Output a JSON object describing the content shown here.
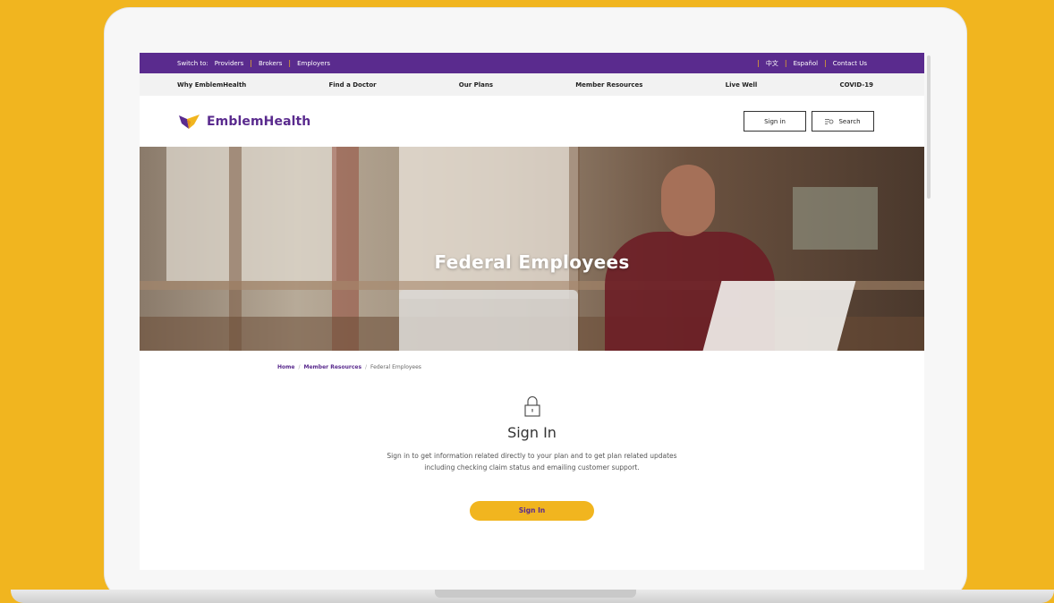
{
  "utility": {
    "switch_label": "Switch to:",
    "links": [
      "Providers",
      "Brokers",
      "Employers"
    ],
    "right_links": [
      "中文",
      "Español",
      "Contact Us"
    ]
  },
  "nav": {
    "items": [
      "Why EmblemHealth",
      "Find a Doctor",
      "Our Plans",
      "Member Resources",
      "Live Well",
      "COVID-19"
    ]
  },
  "header": {
    "logo_text": "EmblemHealth",
    "signin_label": "Sign in",
    "search_label": "Search"
  },
  "hero": {
    "title": "Federal Employees"
  },
  "breadcrumb": {
    "items": [
      "Home",
      "Member Resources",
      "Federal Employees"
    ]
  },
  "signin": {
    "title": "Sign In",
    "description": "Sign in to get information related directly to your plan and to get plan related updates including checking claim status and emailing customer support.",
    "button_label": "Sign In"
  },
  "colors": {
    "brand_purple": "#5a2b8e",
    "brand_yellow": "#f1b51f"
  }
}
